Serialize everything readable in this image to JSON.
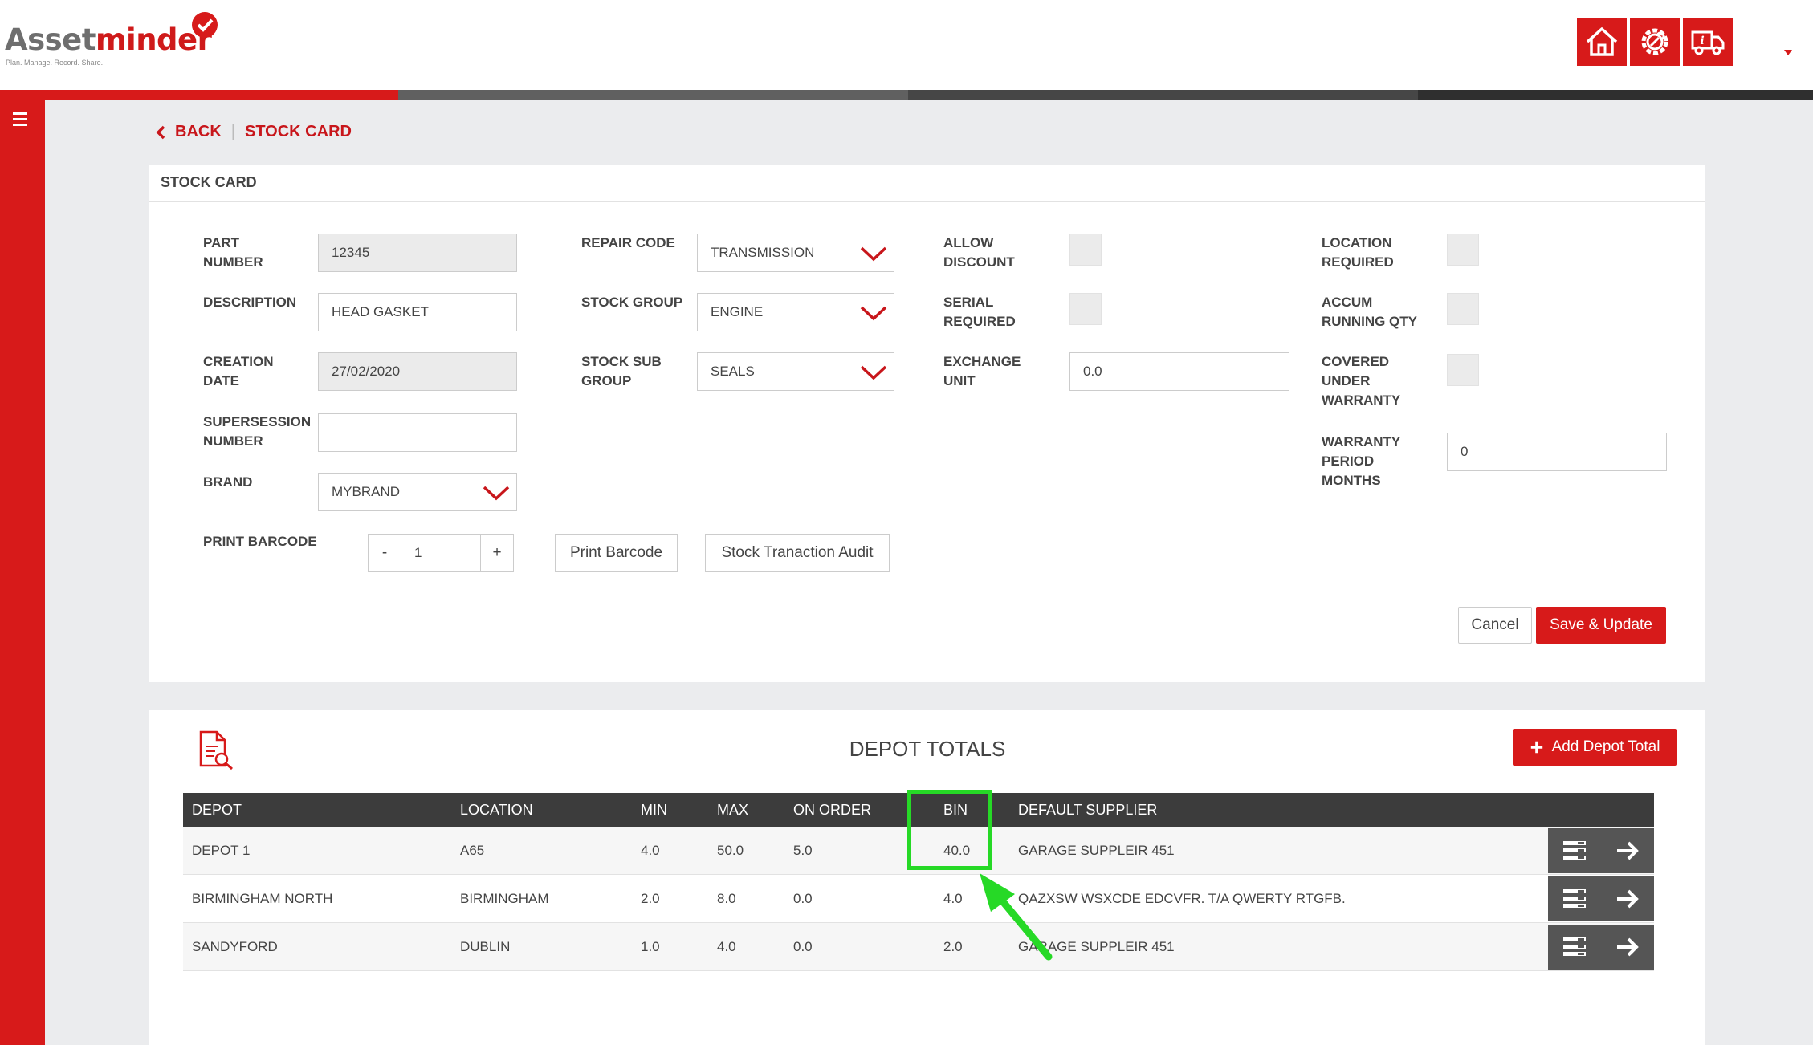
{
  "header": {
    "logo_part1": "Asset",
    "logo_part2": "minder",
    "logo_tagline": "Plan. Manage. Record. Share.",
    "icons": [
      "home-icon",
      "gear-wrench-icon",
      "truck-info-icon"
    ],
    "progress_colors": [
      "#d71a1a",
      "#606060",
      "#464646",
      "#2f2f2f"
    ]
  },
  "breadcrumb": {
    "back": "BACK",
    "current": "STOCK CARD"
  },
  "stock_card": {
    "title": "STOCK CARD",
    "part_number": {
      "label1": "PART",
      "label2": "NUMBER",
      "value": "12345"
    },
    "description": {
      "label": "DESCRIPTION",
      "value": "HEAD GASKET"
    },
    "creation_date": {
      "label1": "CREATION",
      "label2": "DATE",
      "value": "27/02/2020"
    },
    "supersession": {
      "label1": "SUPERSESSION",
      "label2": "NUMBER",
      "value": ""
    },
    "brand": {
      "label": "BRAND",
      "value": "MYBRAND"
    },
    "print_barcode": {
      "label": "PRINT BARCODE",
      "minus": "-",
      "qty": "1",
      "plus": "+"
    },
    "repair_code": {
      "label": "REPAIR CODE",
      "value": "TRANSMISSION"
    },
    "stock_group": {
      "label": "STOCK GROUP",
      "value": "ENGINE"
    },
    "stock_sub_group": {
      "label1": "STOCK SUB",
      "label2": "GROUP",
      "value": "SEALS"
    },
    "allow_discount": {
      "label1": "ALLOW",
      "label2": "DISCOUNT"
    },
    "serial_required": {
      "label1": "SERIAL",
      "label2": "REQUIRED"
    },
    "exchange_unit": {
      "label1": "EXCHANGE",
      "label2": "UNIT",
      "value": "0.0"
    },
    "location_required": {
      "label1": "LOCATION",
      "label2": "REQUIRED"
    },
    "accum_running": {
      "label1": "ACCUM",
      "label2": "RUNNING QTY"
    },
    "covered_warranty": {
      "label1": "COVERED",
      "label2": "UNDER",
      "label3": "WARRANTY"
    },
    "warranty_period": {
      "label1": "WARRANTY",
      "label2": "PERIOD",
      "label3": "MONTHS",
      "value": "0"
    },
    "buttons": {
      "print_barcode": "Print Barcode",
      "stock_audit": "Stock Tranaction Audit",
      "cancel": "Cancel",
      "save": "Save & Update"
    }
  },
  "depot_totals": {
    "title": "DEPOT TOTALS",
    "add_button": "Add Depot Total",
    "columns": [
      "DEPOT",
      "LOCATION",
      "MIN",
      "MAX",
      "ON ORDER",
      "BIN",
      "DEFAULT SUPPLIER"
    ],
    "rows": [
      [
        "DEPOT 1",
        "A65",
        "4.0",
        "50.0",
        "5.0",
        "40.0",
        "GARAGE SUPPLEIR 451"
      ],
      [
        "BIRMINGHAM NORTH",
        "BIRMINGHAM",
        "2.0",
        "8.0",
        "0.0",
        "4.0",
        "QAZXSW WSXCDE EDCVFR. T/A QWERTY RTGFB."
      ],
      [
        "SANDYFORD",
        "DUBLIN",
        "1.0",
        "4.0",
        "0.0",
        "2.0",
        "GARAGE SUPPLEIR 451"
      ]
    ]
  },
  "annotation_color": "#26d926"
}
